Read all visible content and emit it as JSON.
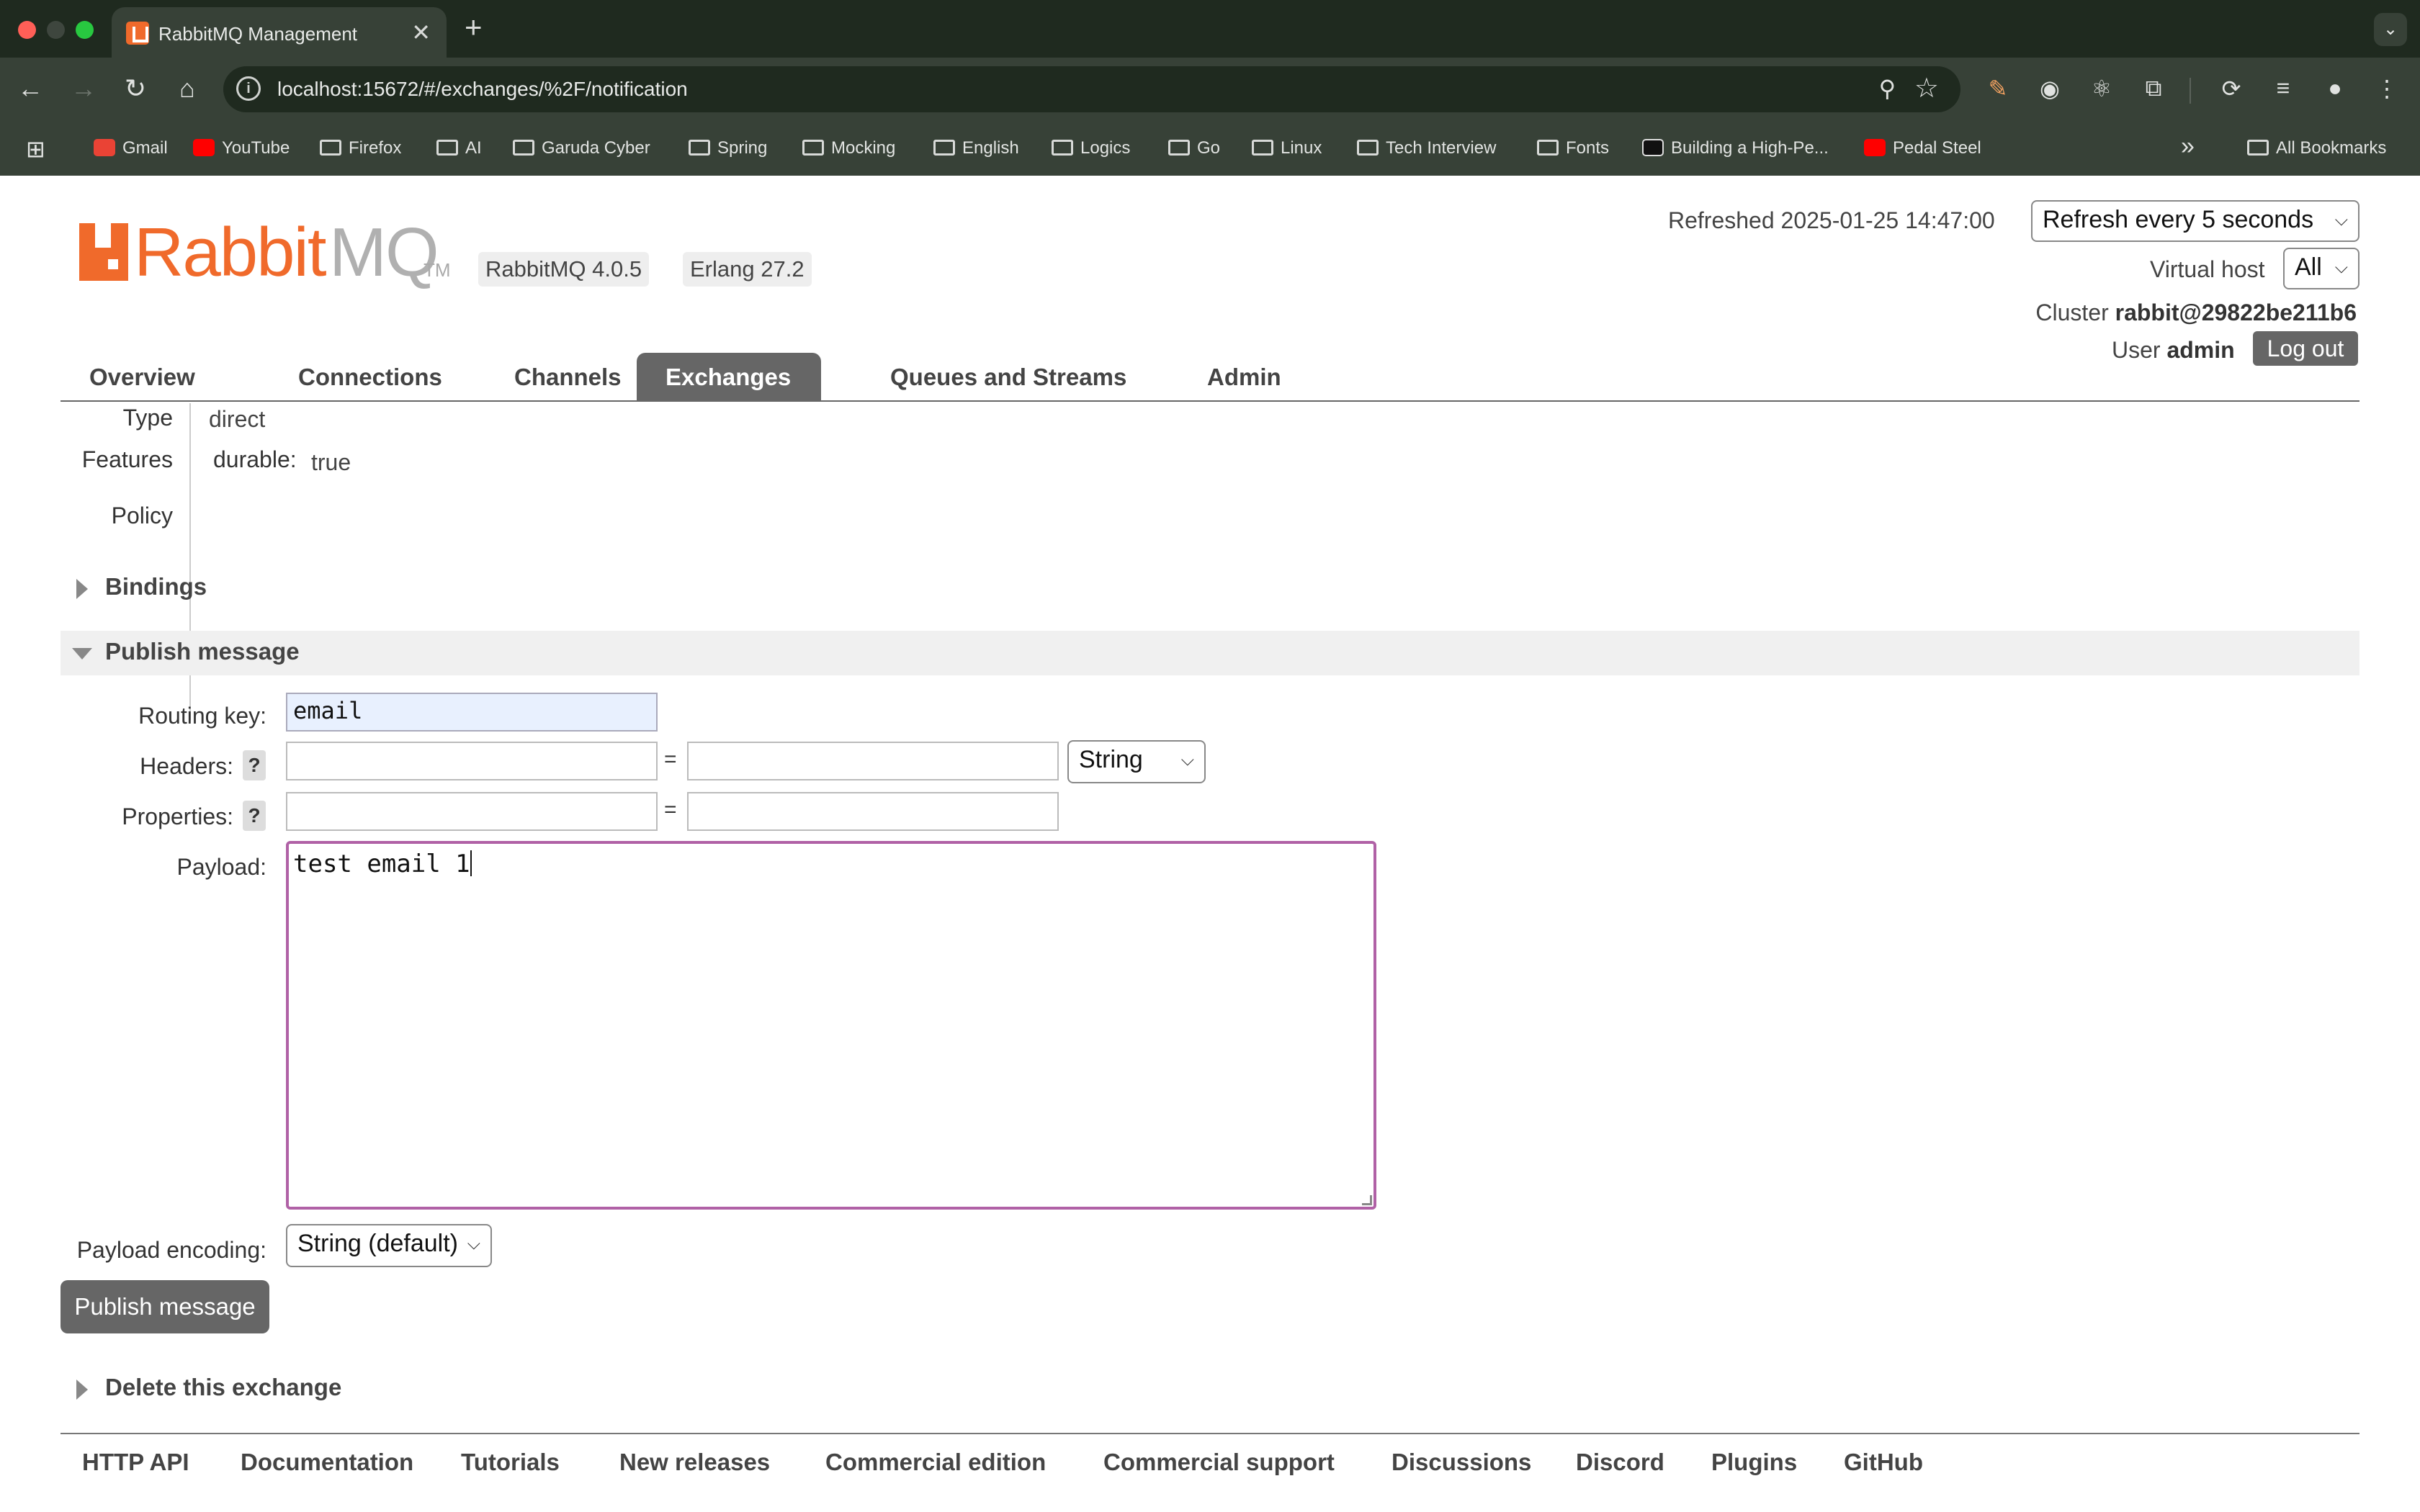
{
  "browser": {
    "tab_title": "RabbitMQ Management",
    "tab_close": "✕",
    "new_tab": "+",
    "url": "localhost:15672/#/exchanges/%2F/notification",
    "bookmarks": [
      "Gmail",
      "YouTube",
      "Firefox",
      "AI",
      "Garuda Cyber",
      "Spring",
      "Mocking",
      "English",
      "Logics",
      "Go",
      "Linux",
      "Tech Interview",
      "Fonts",
      "Building a High-Pe...",
      "Pedal Steel"
    ],
    "bookmarks_overflow": "»",
    "all_bookmarks": "All Bookmarks",
    "icons": [
      "back-icon",
      "forward-icon",
      "reload-icon",
      "home-icon",
      "info-icon",
      "zoom-icon",
      "star-icon",
      "apps-icon",
      "folder-icon",
      "extensions-icon",
      "menu-icon"
    ]
  },
  "header": {
    "logo_rabbit": "Rabbit",
    "logo_mq": "MQ",
    "logo_tm": "TM",
    "rabbitmq_version": "RabbitMQ 4.0.5",
    "erlang_version": "Erlang 27.2",
    "refreshed": "Refreshed 2025-01-25 14:47:00",
    "refresh_select": "Refresh every 5 seconds",
    "virtual_host_label": "Virtual host",
    "virtual_host_value": "All",
    "cluster_label": "Cluster",
    "cluster_value": "rabbit@29822be211b6",
    "user_label": "User",
    "user_value": "admin",
    "logout": "Log out"
  },
  "nav": {
    "tabs": [
      "Overview",
      "Connections",
      "Channels",
      "Exchanges",
      "Queues and Streams",
      "Admin"
    ],
    "active": "Exchanges"
  },
  "details": {
    "type_label": "Type",
    "type_value": "direct",
    "features_label": "Features",
    "features_key": "durable:",
    "features_value": "true",
    "policy_label": "Policy"
  },
  "sections": {
    "bindings": "Bindings",
    "publish": "Publish message",
    "delete": "Delete this exchange"
  },
  "publish_form": {
    "routing_key_label": "Routing key:",
    "routing_key_value": "email",
    "headers_label": "Headers:",
    "properties_label": "Properties:",
    "help": "?",
    "equals": "=",
    "headers_type": "String",
    "payload_label": "Payload:",
    "payload_value": "test email 1",
    "encoding_label": "Payload encoding:",
    "encoding_value": "String (default)",
    "publish_button": "Publish message"
  },
  "footer": {
    "links": [
      "HTTP API",
      "Documentation",
      "Tutorials",
      "New releases",
      "Commercial edition",
      "Commercial support",
      "Discussions",
      "Discord",
      "Plugins",
      "GitHub"
    ]
  },
  "colors": {
    "brand": "#f06a2b",
    "nav_active": "#666666",
    "payload_focus": "#b061a6"
  }
}
